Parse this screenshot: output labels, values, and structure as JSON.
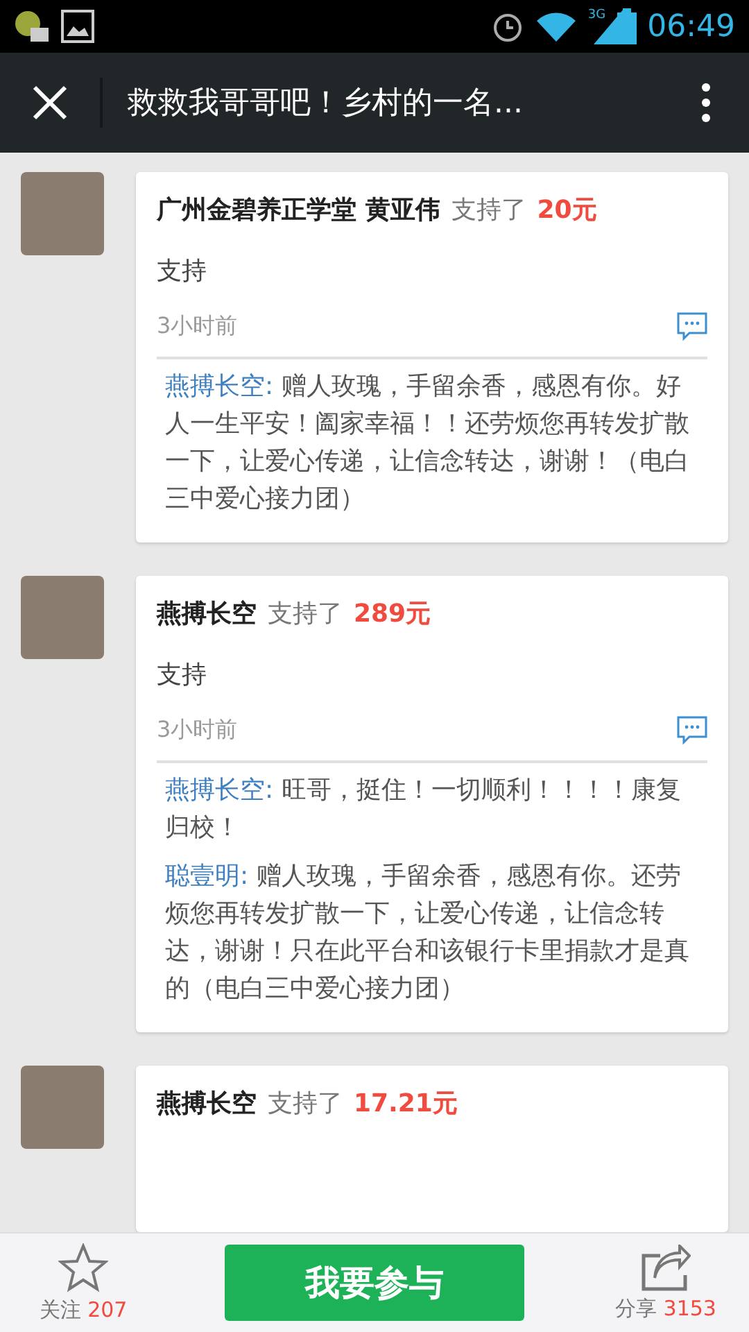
{
  "status_bar": {
    "time": "06:49",
    "network": "3G"
  },
  "toolbar": {
    "title": "救救我哥哥吧！乡村的一名..."
  },
  "donations": [
    {
      "donor": "广州金碧养正学堂 黄亚伟",
      "action": "支持了",
      "amount": "20元",
      "comment": "支持",
      "time": "3小时前",
      "replies": [
        {
          "author": "燕搏长空:",
          "text": "赠人玫瑰，手留余香，感恩有你。好人一生平安！阖家幸福！！还劳烦您再转发扩散一下，让爱心传递，让信念转达，谢谢！（电白三中爱心接力团）"
        }
      ]
    },
    {
      "donor": "燕搏长空",
      "action": "支持了",
      "amount": "289元",
      "comment": "支持",
      "time": "3小时前",
      "replies": [
        {
          "author": "燕搏长空:",
          "text": "旺哥，挺住！一切顺利！！！！康复归校！"
        },
        {
          "author": "聪壹明:",
          "text": "赠人玫瑰，手留余香，感恩有你。还劳烦您再转发扩散一下，让爱心传递，让信念转达，谢谢！只在此平台和该银行卡里捐款才是真的（电白三中爱心接力团）"
        }
      ]
    },
    {
      "donor": "燕搏长空",
      "action": "支持了",
      "amount": "17.21元"
    }
  ],
  "bottom_bar": {
    "follow_label": "关注",
    "follow_count": "207",
    "join_button": "我要参与",
    "share_label": "分享",
    "share_count": "3153"
  }
}
